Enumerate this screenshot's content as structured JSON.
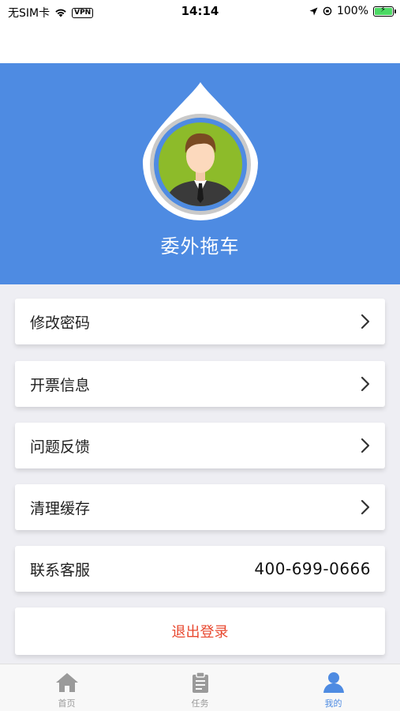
{
  "status_bar": {
    "carrier": "无SIM卡",
    "vpn": "VPN",
    "time": "14:14",
    "battery": "100%"
  },
  "profile": {
    "name": "委外拖车",
    "avatar_icon": "businessman-avatar-icon"
  },
  "menu": [
    {
      "label": "修改密码",
      "icon": "chevron-right-icon"
    },
    {
      "label": "开票信息",
      "icon": "chevron-right-icon"
    },
    {
      "label": "问题反馈",
      "icon": "chevron-right-icon"
    },
    {
      "label": "清理缓存",
      "icon": "chevron-right-icon"
    }
  ],
  "contact": {
    "label": "联系客服",
    "phone": "400-699-0666"
  },
  "logout": {
    "label": "退出登录"
  },
  "tabs": [
    {
      "label": "首页",
      "icon": "home-icon",
      "active": false
    },
    {
      "label": "任务",
      "icon": "clipboard-icon",
      "active": false
    },
    {
      "label": "我的",
      "icon": "user-icon",
      "active": true
    }
  ],
  "colors": {
    "primary": "#4e8be2",
    "danger": "#e8482f",
    "background": "#eeeef3",
    "tab_inactive": "#9a9a9a"
  }
}
